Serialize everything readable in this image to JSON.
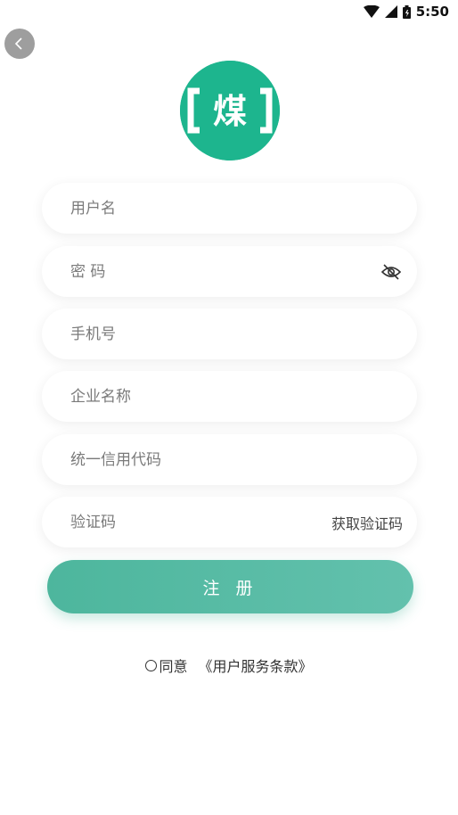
{
  "status_bar": {
    "time": "5:50"
  },
  "logo": {
    "char": "煤",
    "color": "#1db58e"
  },
  "form": {
    "username_placeholder": "用户名",
    "password_placeholder": "密 码",
    "phone_placeholder": "手机号",
    "company_placeholder": "企业名称",
    "credit_code_placeholder": "统一信用代码",
    "verify_code_placeholder": "验证码",
    "get_code_label": "获取验证码"
  },
  "submit": {
    "label": "注 册"
  },
  "agreement": {
    "agree_text": "同意",
    "terms_link": "《用户服务条款》"
  },
  "colors": {
    "accent": "#4db69d",
    "logo_green": "#1db58e"
  }
}
